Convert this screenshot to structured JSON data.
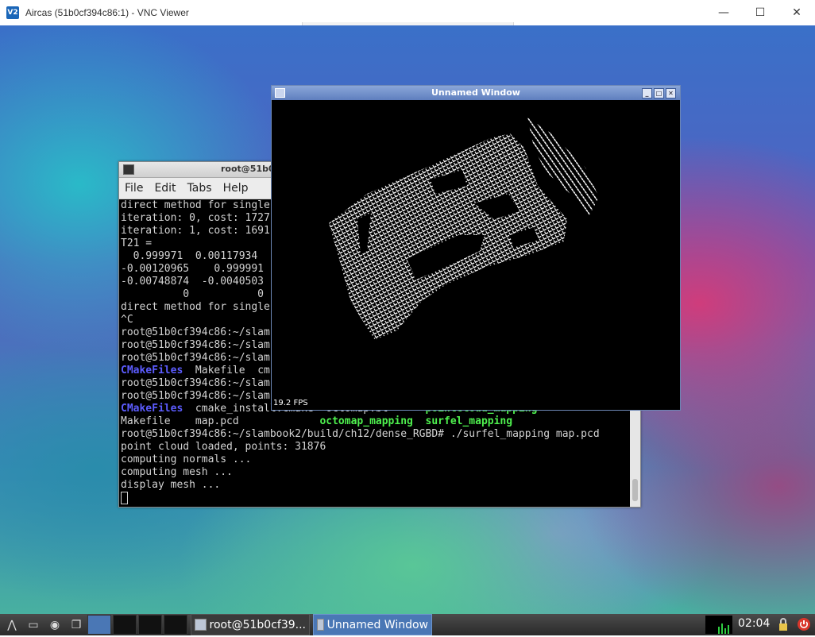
{
  "vnc": {
    "title": "Aircas (51b0cf394c86:1) - VNC Viewer",
    "logo_text": "V2",
    "minimize": "—",
    "maximize": "☐",
    "close": "✕"
  },
  "terminal": {
    "title": "root@51b0",
    "menu": [
      "File",
      "Edit",
      "Tabs",
      "Help"
    ],
    "lines": [
      "direct method for single",
      "iteration: 0, cost: 1727",
      "iteration: 1, cost: 1691",
      "T21 =",
      "  0.999971  0.00117934",
      "-0.00120965    0.999991",
      "-0.00748874  -0.0040503",
      "          0           0",
      "direct method for single",
      "^C",
      "root@51b0cf394c86:~/slam",
      "root@51b0cf394c86:~/slam",
      "root@51b0cf394c86:~/slam"
    ],
    "ls1": {
      "dir": "CMakeFiles",
      "rest": "  Makefile  cm"
    },
    "prompt4": "root@51b0cf394c86:~/slam",
    "prompt5": "root@51b0cf394c86:~/slam",
    "ls2": {
      "dir": "CMakeFiles",
      "rest": "  cmake_install.cmake  octomap.bt      ",
      "exe": "pointcloud_mapping"
    },
    "ls3": {
      "file": "Makefile    map.pcd             ",
      "exe1": "octomap_mapping",
      "sep": "  ",
      "exe2": "surfel_mapping"
    },
    "tail": [
      "root@51b0cf394c86:~/slambook2/build/ch12/dense_RGBD# ./surfel_mapping map.pcd",
      "point cloud loaded, points: 31876",
      "computing normals ...",
      "computing mesh ...",
      "display mesh ..."
    ]
  },
  "viewer": {
    "title": "Unnamed Window",
    "fps": "19.2 FPS"
  },
  "taskbar": {
    "terminal_task": "root@51b0cf39...",
    "viewer_task": "Unnamed Window",
    "clock": "02:04"
  }
}
